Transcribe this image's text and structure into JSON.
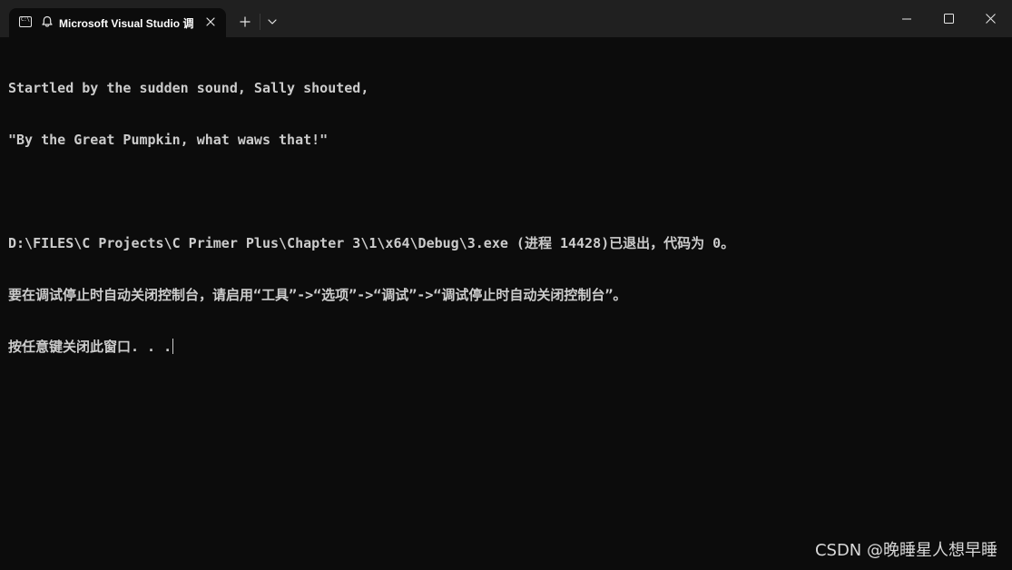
{
  "tab": {
    "title": "Microsoft Visual Studio 调",
    "app_icon": "console-icon",
    "app_icon_text": "C:\\",
    "bell_icon": "bell-icon",
    "close_icon": "close-icon"
  },
  "titlebar": {
    "new_tab_icon": "plus-icon",
    "dropdown_icon": "chevron-down-icon",
    "minimize_icon": "minimize-icon",
    "maximize_icon": "maximize-icon",
    "close_icon": "close-icon"
  },
  "console": {
    "lines": [
      "Startled by the sudden sound, Sally shouted,",
      "\"By the Great Pumpkin, what waws that!\"",
      "",
      "D:\\FILES\\C Projects\\C Primer Plus\\Chapter 3\\1\\x64\\Debug\\3.exe (进程 14428)已退出，代码为 0。",
      "要在调试停止时自动关闭控制台，请启用“工具”->“选项”->“调试”->“调试停止时自动关闭控制台”。",
      "按任意键关闭此窗口. . ."
    ]
  },
  "watermark": "CSDN @晚睡星人想早睡",
  "colors": {
    "background": "#0c0c0c",
    "titlebar": "#202020",
    "text": "#cccccc"
  }
}
